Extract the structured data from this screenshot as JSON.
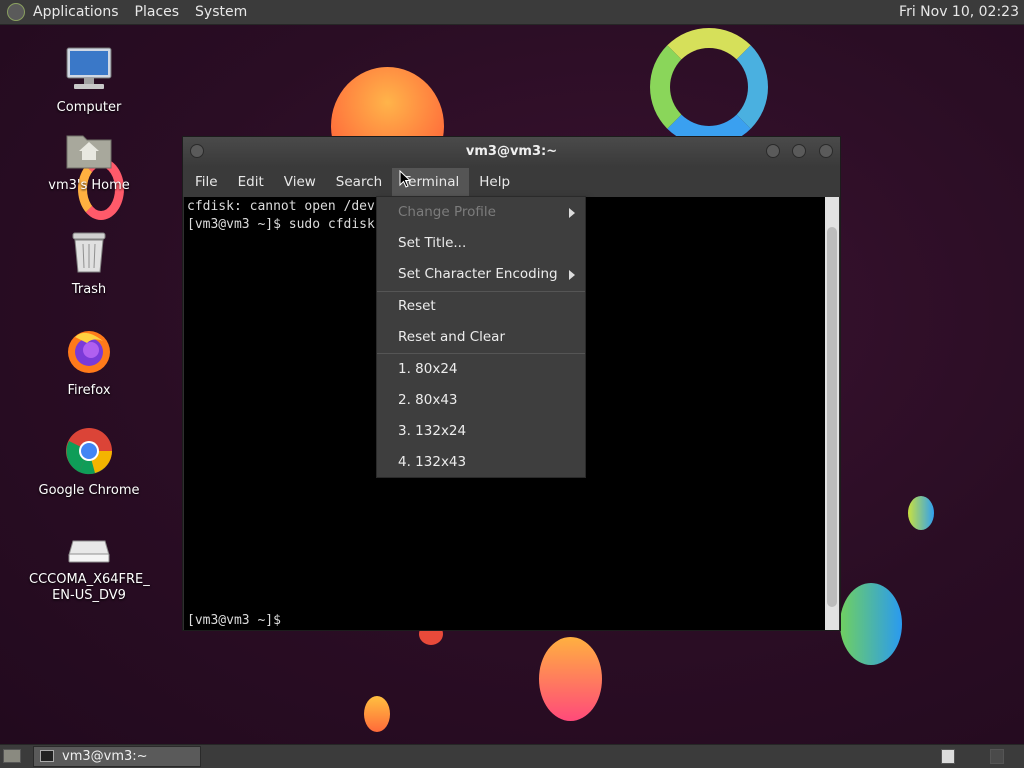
{
  "top_panel": {
    "menus": [
      "Applications",
      "Places",
      "System"
    ],
    "clock": "Fri Nov 10, 02:23"
  },
  "desktop_icons": [
    {
      "label": "Computer",
      "icon": "computer-icon"
    },
    {
      "label": "vm3's Home",
      "icon": "home-folder-icon"
    },
    {
      "label": "Trash",
      "icon": "trash-icon"
    },
    {
      "label": "Firefox",
      "icon": "firefox-icon"
    },
    {
      "label": "Google Chrome",
      "icon": "chrome-icon"
    },
    {
      "label": "CCCOMA_X64FRE_\nEN-US_DV9",
      "icon": "drive-icon"
    }
  ],
  "terminal": {
    "title": "vm3@vm3:~",
    "menubar": [
      "File",
      "Edit",
      "View",
      "Search",
      "Terminal",
      "Help"
    ],
    "active_menu": "Terminal",
    "lines": [
      "cfdisk: cannot open /dev",
      "[vm3@vm3 ~]$ sudo cfdisk",
      "[vm3@vm3 ~]$"
    ]
  },
  "terminal_menu": {
    "items": [
      {
        "label": "Change Profile",
        "disabled": true,
        "submenu": true
      },
      {
        "label": "Set Title...",
        "disabled": false,
        "submenu": false
      },
      {
        "label": "Set Character Encoding",
        "disabled": false,
        "submenu": true
      },
      {
        "label": "Reset",
        "disabled": false,
        "submenu": false
      },
      {
        "label": "Reset and Clear",
        "disabled": false,
        "submenu": false
      },
      {
        "label": "1. 80x24",
        "disabled": false,
        "submenu": false
      },
      {
        "label": "2. 80x43",
        "disabled": false,
        "submenu": false
      },
      {
        "label": "3. 132x24",
        "disabled": false,
        "submenu": false
      },
      {
        "label": "4. 132x43",
        "disabled": false,
        "submenu": false
      }
    ]
  },
  "taskbar": {
    "window_button": "vm3@vm3:~"
  },
  "colors": {
    "panel": "#3b3b3b",
    "menu_bg": "#3e3e3e",
    "terminal_bg": "#000000"
  }
}
